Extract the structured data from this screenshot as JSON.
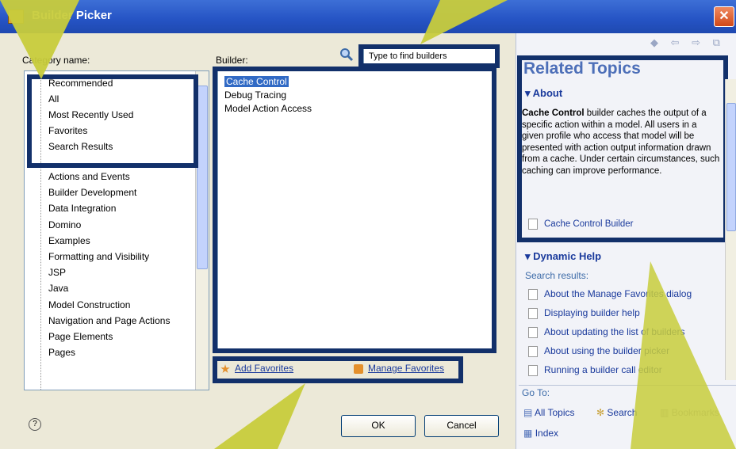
{
  "window": {
    "title": "Builder Picker"
  },
  "category": {
    "label": "Category name:",
    "items": [
      "Recommended",
      "All",
      "Most Recently Used",
      "Favorites",
      "Search Results",
      "Actions and Events",
      "Builder Development",
      "Data Integration",
      "Domino",
      "Examples",
      "Formatting and Visibility",
      "JSP",
      "Java",
      "Model Construction",
      "Navigation and Page Actions",
      "Page Elements",
      "Pages"
    ]
  },
  "builder": {
    "label": "Builder:",
    "search_placeholder": "Type to find builders",
    "items": [
      "Cache Control",
      "Debug Tracing",
      "Model Action Access"
    ]
  },
  "favorites": {
    "add": "Add Favorites",
    "manage": "Manage Favorites"
  },
  "buttons": {
    "ok": "OK",
    "cancel": "Cancel"
  },
  "related": {
    "title": "Related Topics",
    "about_heading": "About",
    "about_bold": "Cache Control",
    "about_text": "builder caches the output of a specific action within a model. All users in a given profile who access that model will be presented with action output information drawn from a cache. Under certain circumstances, such caching can improve performance.",
    "about_link": "Cache Control Builder",
    "dynamic_heading": "Dynamic Help",
    "search_results_label": "Search results:",
    "results": [
      "About the Manage Favorites dialog",
      "Displaying builder help",
      "About updating the list of builders",
      "About using the builder picker",
      "Running a builder call editor"
    ],
    "goto_label": "Go To:",
    "goto_all": "All Topics",
    "goto_search": "Search",
    "goto_bookmarks": "Bookmarks",
    "goto_index": "Index"
  },
  "colors": {
    "title_bar": "#2553c4",
    "highlight_box": "#12306a",
    "callout_arrow": "#c8cc3c",
    "selection": "#316ac5"
  }
}
